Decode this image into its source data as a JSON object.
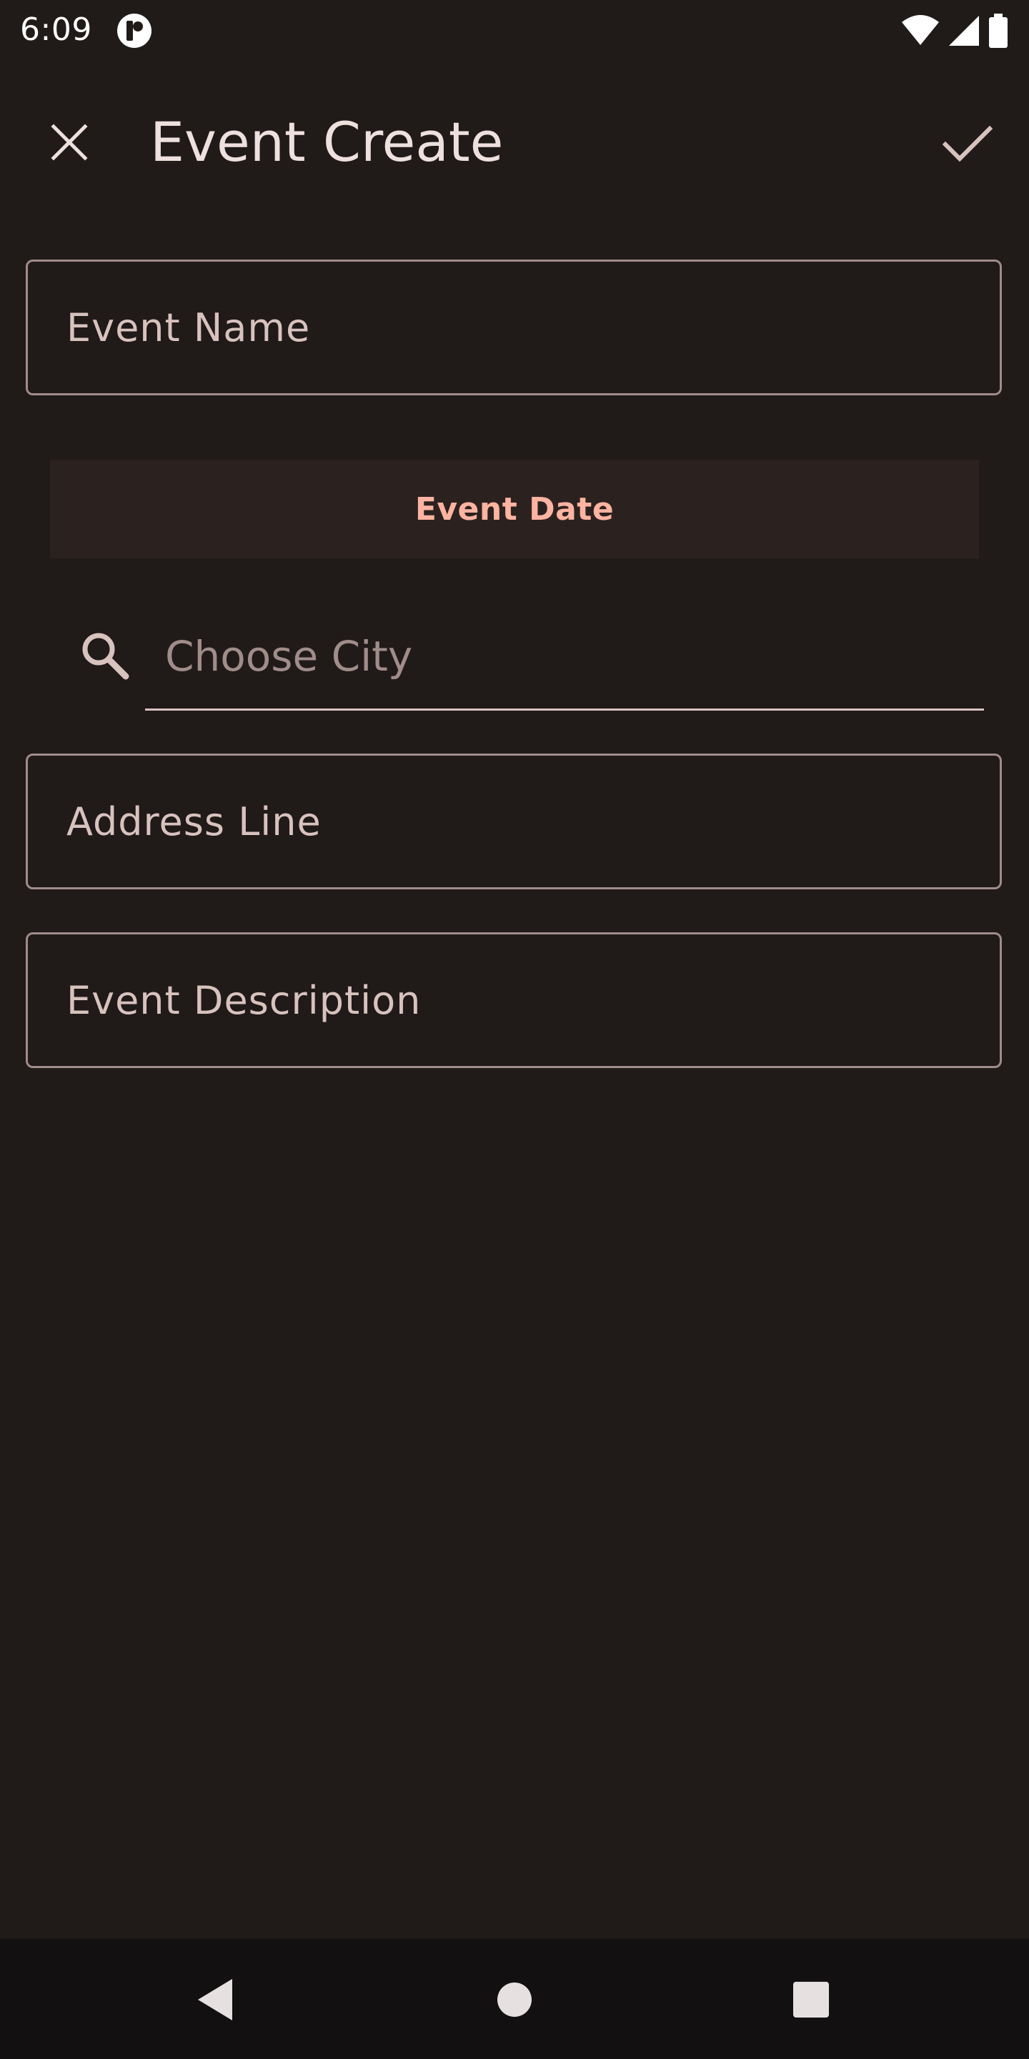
{
  "status_bar": {
    "time": "6:09"
  },
  "app_bar": {
    "title": "Event Create",
    "close_icon": "close-icon",
    "confirm_icon": "check-icon"
  },
  "form": {
    "event_name_label": "Event Name",
    "event_date_label": "Event Date",
    "city_placeholder": "Choose City",
    "address_label": "Address Line",
    "description_label": "Event Description"
  },
  "nav": {
    "back_icon": "back-triangle-icon",
    "home_icon": "home-circle-icon",
    "recents_icon": "recents-square-icon"
  },
  "colors": {
    "background": "#201a19",
    "accent": "#ffb4a1",
    "outline": "#a08c89",
    "on_surface": "#ede0dd"
  }
}
